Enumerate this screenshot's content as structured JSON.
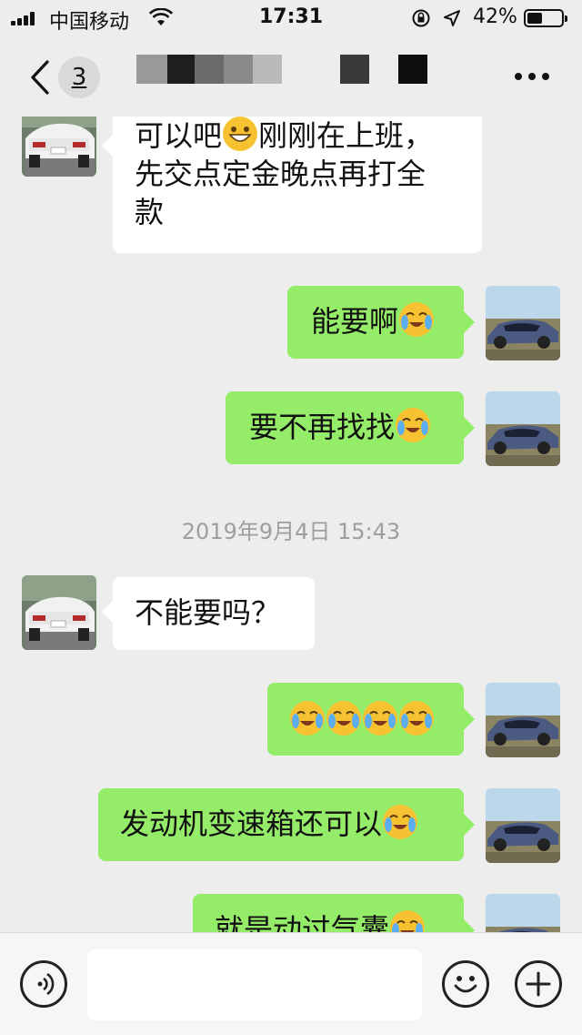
{
  "status_bar": {
    "carrier": "中国移动",
    "time": "17:31",
    "battery_percent": "42%",
    "icons": [
      "signal-icon",
      "wifi-icon",
      "rotation-lock-icon",
      "location-icon",
      "battery-icon"
    ]
  },
  "nav": {
    "unread_count": "3",
    "title_censored": true,
    "icons": [
      "back-icon",
      "more-icon"
    ]
  },
  "messages": [
    {
      "side": "in",
      "lines": [
        "可以吧",
        "刚刚在上班，",
        "先交点定金晚点再打全",
        "款"
      ],
      "emoji_after_first": "smile"
    },
    {
      "side": "out",
      "text": "能要啊",
      "emoji": "cry"
    },
    {
      "side": "out",
      "text": "要不再找找",
      "emoji": "cry"
    },
    {
      "side": "in",
      "text": "不能要吗？"
    },
    {
      "side": "out",
      "text": "",
      "emoji_count": 4
    },
    {
      "side": "out",
      "text": "发动机变速箱还可以",
      "emoji": "cry"
    },
    {
      "side": "out",
      "text": "就是动过气囊",
      "emoji": "cry"
    }
  ],
  "timestamp": "2019年9月4日 15:43",
  "input_bar": {
    "placeholder": "",
    "icons": [
      "voice-icon",
      "emoji-icon",
      "plus-icon"
    ]
  },
  "colors": {
    "background": "#ededed",
    "bubble_out": "#95ec69",
    "bubble_in": "#ffffff"
  }
}
